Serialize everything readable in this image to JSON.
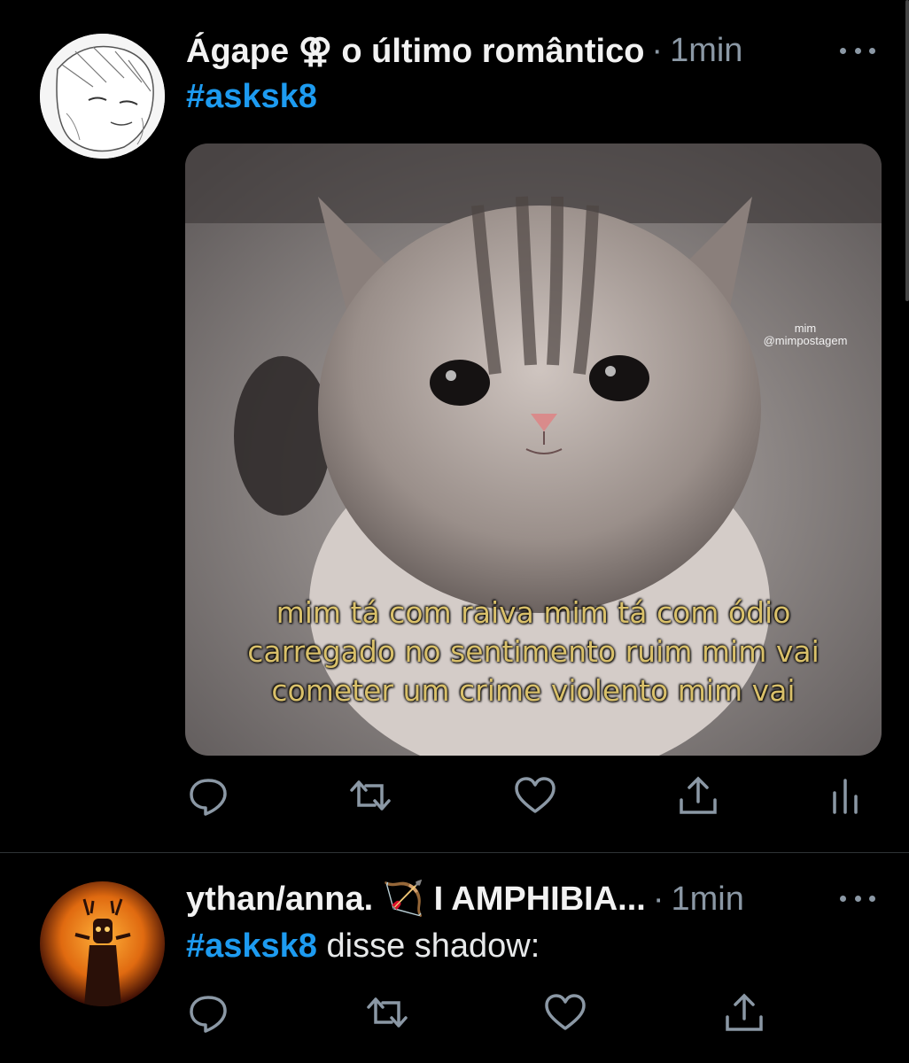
{
  "tweets": [
    {
      "name": "Ágape ⚢ o último romântico",
      "time": "1min",
      "hashtag": "#asksk8",
      "text": "",
      "image": {
        "watermark_line1": "mim",
        "watermark_line2": "@mimpostagem",
        "caption_line1": "mim tá com raiva mim tá com ódio",
        "caption_line2": "carregado no sentimento ruim mim vai",
        "caption_line3": "cometer um crime violento mim vai"
      }
    },
    {
      "name": "ythan/anna. 🏹 I AMPHIBIA...",
      "time": "1min",
      "hashtag": "#asksk8",
      "text": "disse shadow:"
    }
  ],
  "colors": {
    "background": "#000000",
    "hashtag": "#1d9bf0",
    "muted": "#8b98a5",
    "caption": "#d9c06a"
  },
  "icons": [
    "reply-icon",
    "retweet-icon",
    "like-icon",
    "share-icon",
    "analytics-icon",
    "more-icon"
  ]
}
